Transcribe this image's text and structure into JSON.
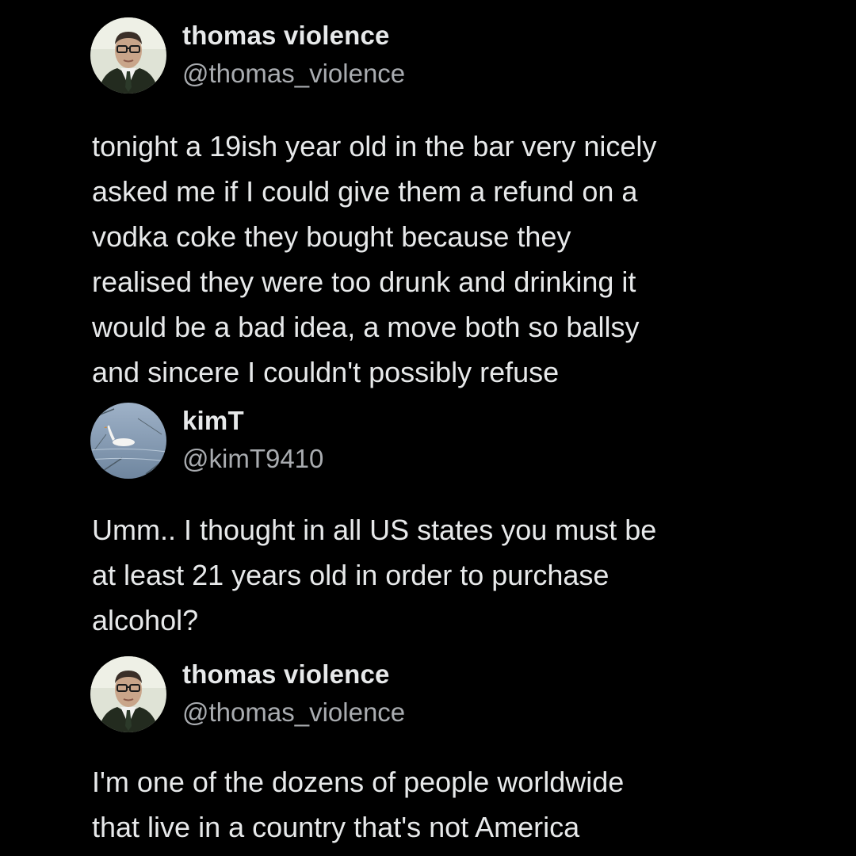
{
  "tweets": [
    {
      "name": "thomas violence",
      "handle": "@thomas_violence",
      "avatar_icon": "man-in-suit-avatar",
      "lines": [
        "tonight a 19ish year old in the bar very nicely",
        "asked me if I could give them a refund on a",
        "vodka coke they bought because they",
        "realised they were too drunk and drinking it",
        "would be a bad idea, a move both so ballsy",
        "and sincere I couldn't possibly refuse"
      ]
    },
    {
      "name": "kimT",
      "handle": "@kimT9410",
      "avatar_icon": "swan-on-water-avatar",
      "lines": [
        "Umm.. I thought in all US states you must be",
        "at least 21 years old in order to purchase",
        "alcohol?"
      ]
    },
    {
      "name": "thomas violence",
      "handle": "@thomas_violence",
      "avatar_icon": "man-in-suit-avatar",
      "lines": [
        "I'm one of the dozens of people worldwide",
        "that live in a country that's not America"
      ]
    }
  ],
  "colors": {
    "background": "#000000",
    "text": "#e7e9ea",
    "handle": "#a9acb0"
  }
}
